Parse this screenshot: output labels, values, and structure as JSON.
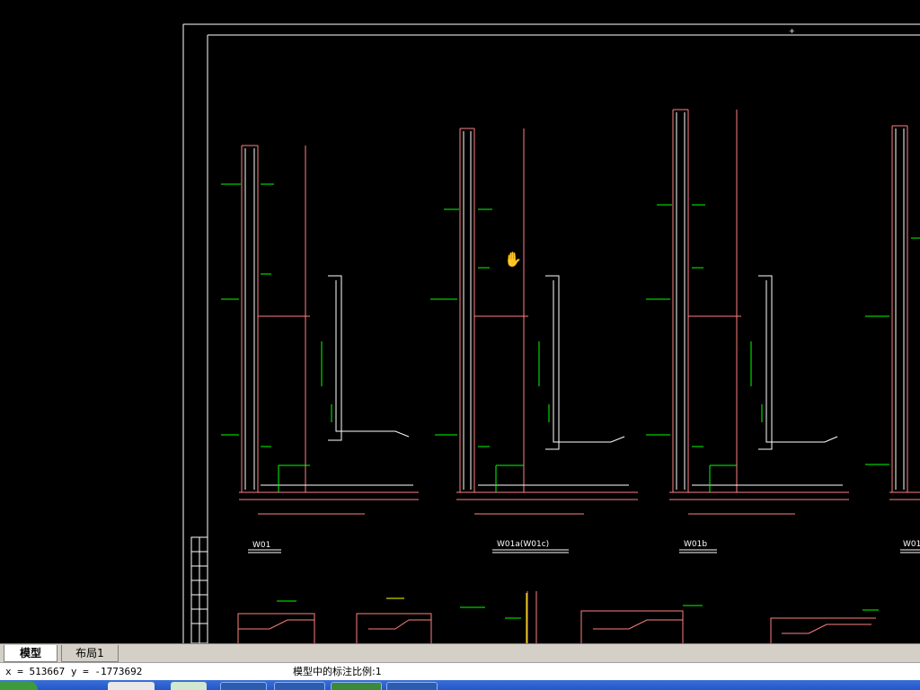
{
  "tabs": [
    {
      "label": "模型",
      "active": true
    },
    {
      "label": "布局1",
      "active": false
    }
  ],
  "status": {
    "coordinates": "x = 513667 y = -1773692",
    "annotation_scale": "模型中的标注比例:1"
  },
  "drawing": {
    "section_labels": [
      "W01",
      "W01a(W01c)",
      "W01b",
      "W01"
    ]
  },
  "colors": {
    "background": "#000000",
    "frame": "#ffffff",
    "wall": "#ff6e6e",
    "rebar": "#ffffff",
    "dimension": "#ff6666",
    "annotation": "#00ff00",
    "highlight": "#ffff00"
  }
}
